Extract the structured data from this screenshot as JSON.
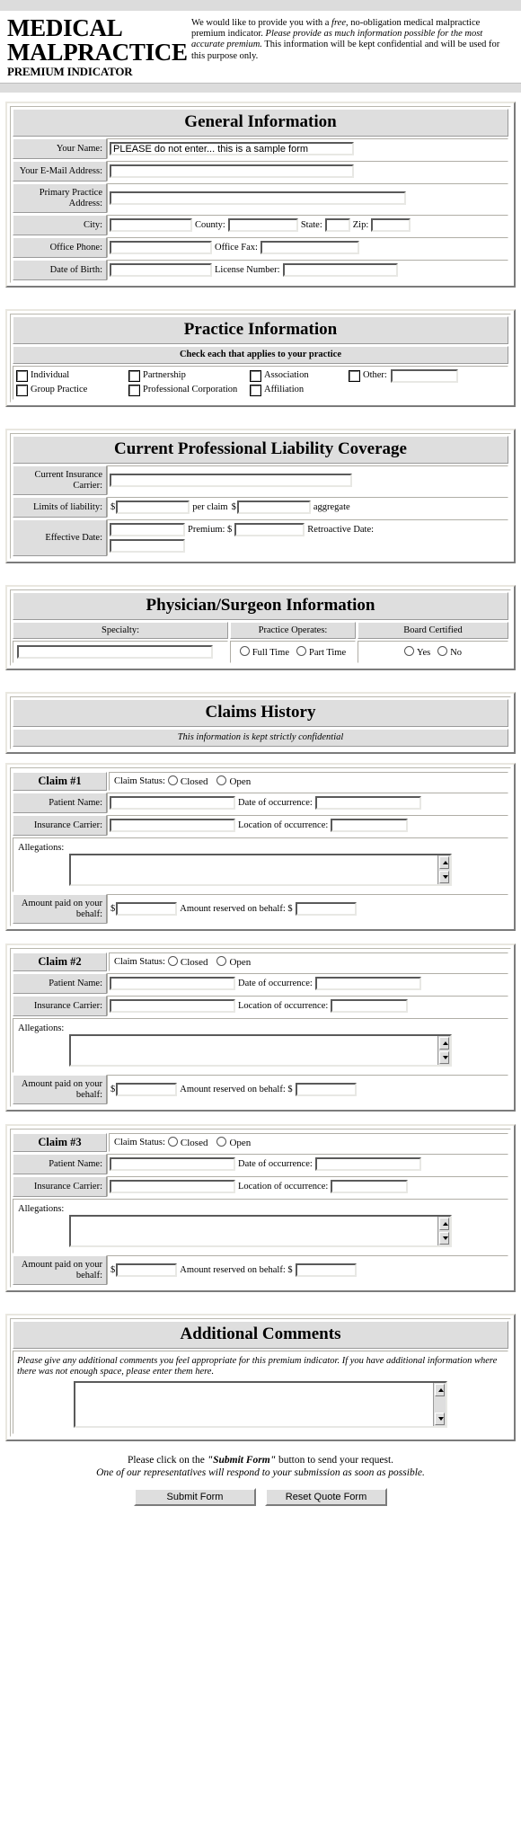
{
  "header": {
    "title_line1": "MEDICAL",
    "title_line2": "MALPRACTICE",
    "title_line3": "PREMIUM INDICATOR",
    "intro_part1": "We would like to provide you with a ",
    "intro_em1": "free",
    "intro_part2": ", no-obligation medical malpractice premium indicator. ",
    "intro_em2": "Please provide as much information possible for the most accurate premium.",
    "intro_part3": " This information will be kept confidential and will be used for this purpose only."
  },
  "general": {
    "title": "General Information",
    "name_label": "Your Name:",
    "name_value": "PLEASE do not enter... this is a sample form",
    "email_label": "Your E-Mail Address:",
    "address_label": "Primary Practice Address:",
    "city_label": "City:",
    "county_label": "County:",
    "state_label": "State:",
    "zip_label": "Zip:",
    "phone_label": "Office Phone:",
    "fax_label": "Office Fax:",
    "dob_label": "Date of Birth:",
    "license_label": "License Number:"
  },
  "practice": {
    "title": "Practice Information",
    "subtitle": "Check each that applies to your practice",
    "options_row1": [
      "Individual",
      "Partnership",
      "Association",
      "Other:"
    ],
    "options_row2": [
      "Group Practice",
      "Professional Corporation",
      "Affiliation"
    ]
  },
  "coverage": {
    "title": "Current Professional Liability Coverage",
    "carrier_label": "Current Insurance Carrier:",
    "limits_label": "Limits of liability:",
    "dollar": "$",
    "per_claim": "per claim",
    "aggregate": "aggregate",
    "effective_label": "Effective Date:",
    "premium_label": "Premium: $",
    "retroactive_label": "Retroactive Date:"
  },
  "physician": {
    "title": "Physician/Surgeon Information",
    "specialty_label": "Specialty:",
    "operates_label": "Practice Operates:",
    "board_label": "Board Certified",
    "full_time": "Full Time",
    "part_time": "Part Time",
    "yes": "Yes",
    "no": "No"
  },
  "claims": {
    "title": "Claims History",
    "subtitle": "This information is kept strictly confidential",
    "status_label": "Claim Status:",
    "closed": "Closed",
    "open": "Open",
    "patient_label": "Patient Name:",
    "occurrence_date_label": "Date of occurrence:",
    "carrier_label": "Insurance Carrier:",
    "occurrence_location_label": "Location of occurrence:",
    "allegations_label": "Allegations:",
    "amount_paid_label": "Amount paid on your behalf:",
    "amount_reserved_label": "Amount reserved on behalf: $",
    "dollar": "$",
    "items": [
      {
        "heading": "Claim #1"
      },
      {
        "heading": "Claim #2"
      },
      {
        "heading": "Claim #3"
      }
    ]
  },
  "comments": {
    "title": "Additional Comments",
    "note_line1": "Please give any additional comments you feel appropriate for this premium indicator. If you have",
    "note_line2": "additional information where there was not enough space, please enter them here."
  },
  "footer": {
    "line1_pre": "Please click on the ",
    "line1_strong": "\"Submit Form\"",
    "line1_post": " button to send your request.",
    "line2": "One of our representatives will respond to your submission as soon as possible.",
    "submit_label": "Submit Form",
    "reset_label": "Reset Quote Form"
  }
}
